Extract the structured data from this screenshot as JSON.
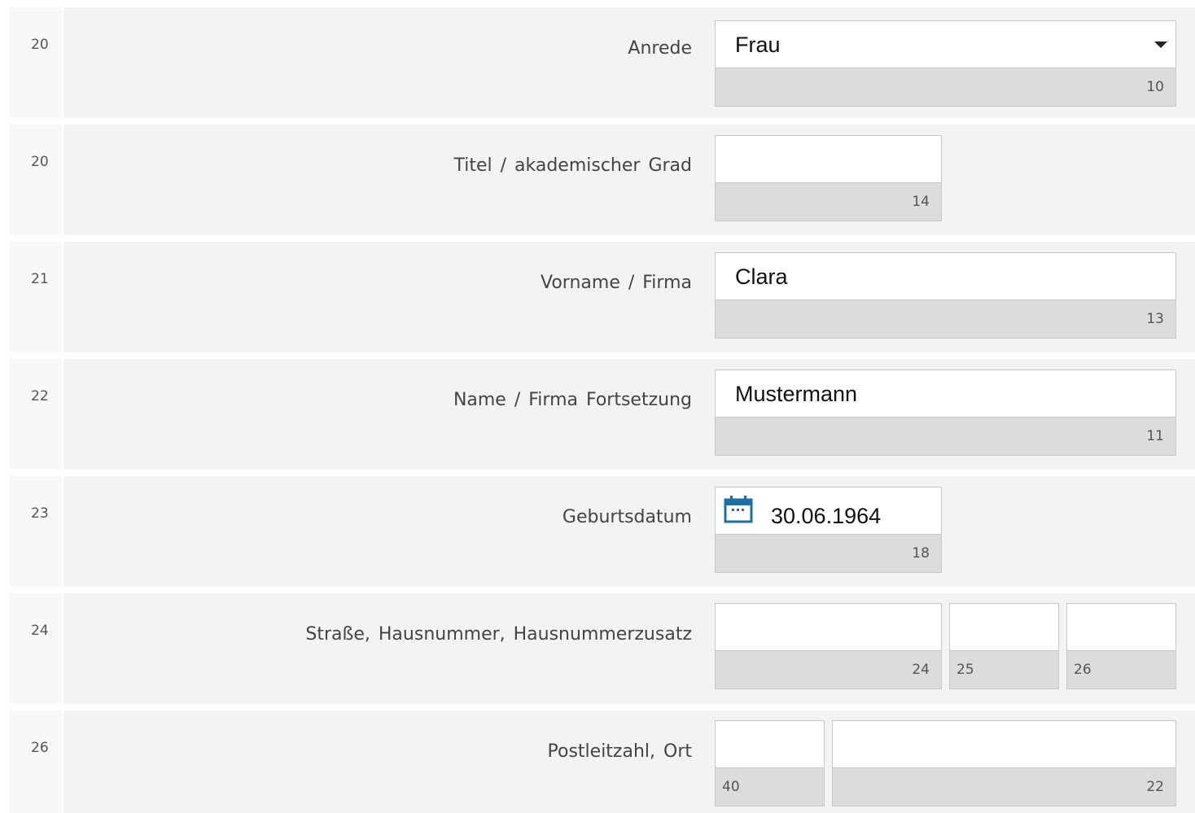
{
  "rows": [
    {
      "line": "20",
      "label": "Anrede",
      "fields": [
        {
          "value": "Frau",
          "counter": "10",
          "type": "select"
        }
      ]
    },
    {
      "line": "20",
      "label": "Titel / akademischer Grad",
      "fields": [
        {
          "value": "",
          "counter": "14"
        }
      ]
    },
    {
      "line": "21",
      "label": "Vorname / Firma",
      "fields": [
        {
          "value": "Clara",
          "counter": "13"
        }
      ]
    },
    {
      "line": "22",
      "label": "Name / Firma Fortsetzung",
      "fields": [
        {
          "value": "Mustermann",
          "counter": "11"
        }
      ]
    },
    {
      "line": "23",
      "label": "Geburtsdatum",
      "fields": [
        {
          "value": "30.06.1964",
          "counter": "18",
          "icon": "calendar-icon"
        }
      ]
    },
    {
      "line": "24",
      "label": "Straße, Hausnummer, Hausnummerzusatz",
      "fields": [
        {
          "value": "",
          "counter": "24"
        },
        {
          "value": "",
          "counter": "25"
        },
        {
          "value": "",
          "counter": "26"
        }
      ]
    },
    {
      "line": "26",
      "label": "Postleitzahl, Ort",
      "fields": [
        {
          "value": "",
          "counter": "40"
        },
        {
          "value": "",
          "counter": "22"
        }
      ]
    }
  ],
  "colors": {
    "calendar_icon": "#1d6fa5",
    "row_bg": "#f3f3f3",
    "counter_bg": "#dcdcdc"
  }
}
